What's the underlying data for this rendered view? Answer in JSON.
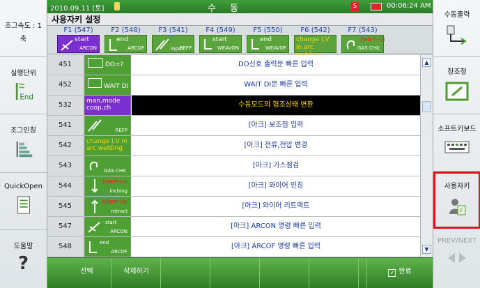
{
  "status": {
    "date": "2010.09.11 [토]",
    "mode": "수 동",
    "s": "S",
    "time": "00:06:24 AM"
  },
  "title": "사용자키 설정",
  "left": [
    {
      "label": "조그속도 : 1",
      "sub": "축"
    },
    {
      "label": "실행단위",
      "icon_text": "End"
    },
    {
      "label": "조그인칭"
    },
    {
      "label": "QuickOpen"
    },
    {
      "label": "도움말",
      "icon_text": "?"
    }
  ],
  "right": [
    {
      "label": "수동출력"
    },
    {
      "label": "창조정"
    },
    {
      "label": "소프트키보드"
    },
    {
      "label": "사용자키"
    },
    {
      "label": "PREV/NEXT"
    }
  ],
  "ftabs": [
    {
      "label": "F1 (547)",
      "text": "ARCON",
      "top": "start"
    },
    {
      "label": "F2 (548)",
      "text": "ARCOF",
      "top": "end"
    },
    {
      "label": "F3 (541)",
      "text": "REFP",
      "top": "input"
    },
    {
      "label": "F4 (549)",
      "text": "WEAVON",
      "top": "start"
    },
    {
      "label": "F5 (550)",
      "text": "WEAVOF",
      "top": "end"
    },
    {
      "label": "F6 (542)",
      "text": "change I,V in arc welding"
    },
    {
      "label": "F7 (543)",
      "text": "GAS CHK.",
      "top": "(SHIFT+1)"
    }
  ],
  "rows": [
    {
      "num": "451",
      "icon": "DO=?",
      "desc": "DO신호 출력문 빠른 입력"
    },
    {
      "num": "452",
      "icon": "WAIT DI",
      "desc": "WAIT DI문 빠른 입력"
    },
    {
      "num": "532",
      "icon": "man,mode coop,ch",
      "desc": "수동모드의 협조상태 변환"
    },
    {
      "num": "541",
      "icon": "REFP",
      "desc": "[아크] 보조점 입력"
    },
    {
      "num": "542",
      "icon": "change I,V in arc welding",
      "desc": "[아크] 전류,전압 변경"
    },
    {
      "num": "543",
      "icon": "GAS CHK.",
      "desc": "[아크] 가스점검"
    },
    {
      "num": "544",
      "icon": "inching",
      "top": "(SHIFT+2)",
      "desc": "[아크] 와이어 인칭"
    },
    {
      "num": "545",
      "icon": "retract",
      "top": "(SHIFT+3)",
      "desc": "[아크] 와이어 리트랙트"
    },
    {
      "num": "547",
      "icon": "ARCON",
      "top": "start",
      "desc": "[아크] ARCON 명령 빠른 입력"
    },
    {
      "num": "548",
      "icon": "ARCOF",
      "top": "end",
      "desc": "[아크] ARCOF 명령 빠른 입력"
    }
  ],
  "bottom": {
    "select": "선택",
    "delete": "삭제하기",
    "done": "완료"
  },
  "colors": {
    "green": "#4fa034",
    "purple": "#7b2fd0",
    "highlight": "#ffd800",
    "active_border": "#e0141e"
  }
}
